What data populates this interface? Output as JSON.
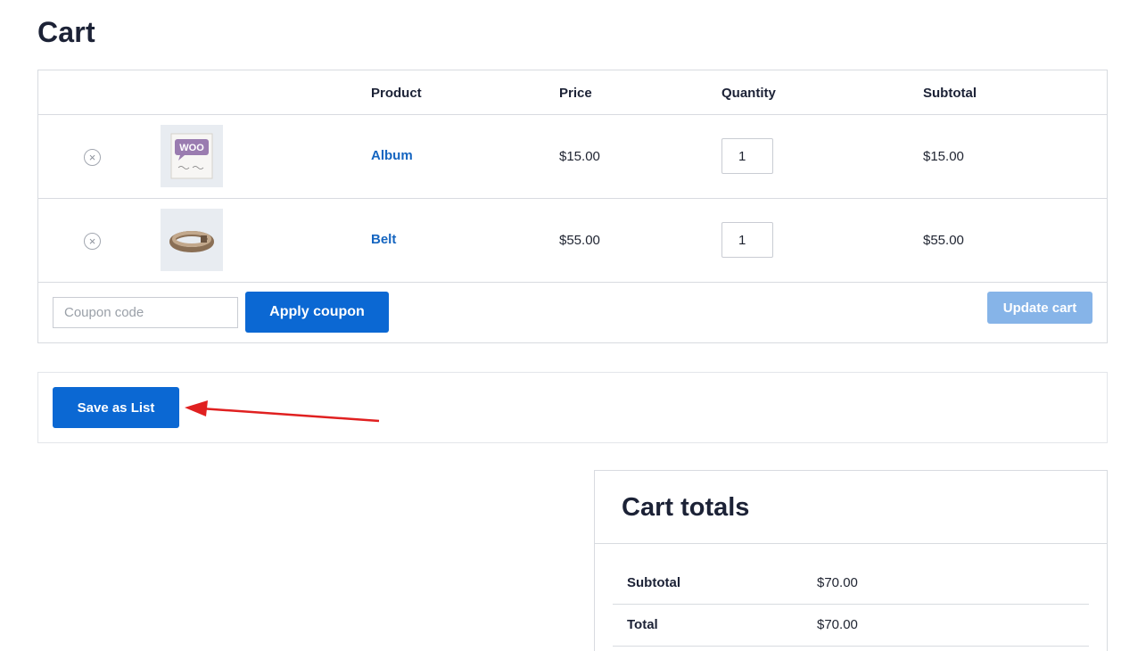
{
  "page": {
    "title": "Cart"
  },
  "table": {
    "headers": {
      "product": "Product",
      "price": "Price",
      "quantity": "Quantity",
      "subtotal": "Subtotal"
    },
    "items": [
      {
        "name": "Album",
        "price": "$15.00",
        "quantity": "1",
        "subtotal": "$15.00",
        "thumb_icon": "woo-album-icon"
      },
      {
        "name": "Belt",
        "price": "$55.00",
        "quantity": "1",
        "subtotal": "$55.00",
        "thumb_icon": "belt-icon"
      }
    ],
    "remove_glyph": "×"
  },
  "coupon": {
    "placeholder": "Coupon code",
    "value": "",
    "apply_label": "Apply coupon"
  },
  "update_label": "Update cart",
  "save_list_label": "Save as List",
  "totals": {
    "title": "Cart totals",
    "rows": [
      {
        "label": "Subtotal",
        "value": "$70.00"
      },
      {
        "label": "Total",
        "value": "$70.00"
      }
    ]
  },
  "colors": {
    "accent": "#0b68d3",
    "link": "#1565c0",
    "disabled_button": "#86b4e8",
    "annotation_arrow": "#e02020"
  }
}
